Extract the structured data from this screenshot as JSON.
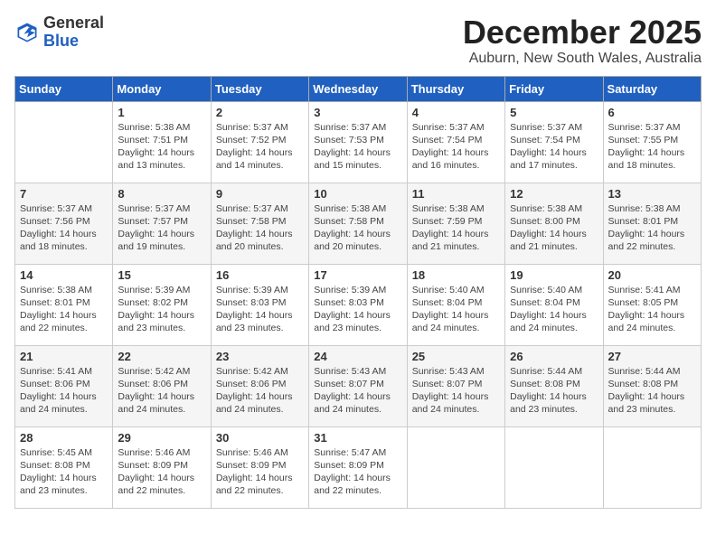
{
  "app": {
    "name_general": "General",
    "name_blue": "Blue"
  },
  "title": "December 2025",
  "location": "Auburn, New South Wales, Australia",
  "days_of_week": [
    "Sunday",
    "Monday",
    "Tuesday",
    "Wednesday",
    "Thursday",
    "Friday",
    "Saturday"
  ],
  "weeks": [
    [
      {
        "day": "",
        "info": ""
      },
      {
        "day": "1",
        "info": "Sunrise: 5:38 AM\nSunset: 7:51 PM\nDaylight: 14 hours\nand 13 minutes."
      },
      {
        "day": "2",
        "info": "Sunrise: 5:37 AM\nSunset: 7:52 PM\nDaylight: 14 hours\nand 14 minutes."
      },
      {
        "day": "3",
        "info": "Sunrise: 5:37 AM\nSunset: 7:53 PM\nDaylight: 14 hours\nand 15 minutes."
      },
      {
        "day": "4",
        "info": "Sunrise: 5:37 AM\nSunset: 7:54 PM\nDaylight: 14 hours\nand 16 minutes."
      },
      {
        "day": "5",
        "info": "Sunrise: 5:37 AM\nSunset: 7:54 PM\nDaylight: 14 hours\nand 17 minutes."
      },
      {
        "day": "6",
        "info": "Sunrise: 5:37 AM\nSunset: 7:55 PM\nDaylight: 14 hours\nand 18 minutes."
      }
    ],
    [
      {
        "day": "7",
        "info": "Sunrise: 5:37 AM\nSunset: 7:56 PM\nDaylight: 14 hours\nand 18 minutes."
      },
      {
        "day": "8",
        "info": "Sunrise: 5:37 AM\nSunset: 7:57 PM\nDaylight: 14 hours\nand 19 minutes."
      },
      {
        "day": "9",
        "info": "Sunrise: 5:37 AM\nSunset: 7:58 PM\nDaylight: 14 hours\nand 20 minutes."
      },
      {
        "day": "10",
        "info": "Sunrise: 5:38 AM\nSunset: 7:58 PM\nDaylight: 14 hours\nand 20 minutes."
      },
      {
        "day": "11",
        "info": "Sunrise: 5:38 AM\nSunset: 7:59 PM\nDaylight: 14 hours\nand 21 minutes."
      },
      {
        "day": "12",
        "info": "Sunrise: 5:38 AM\nSunset: 8:00 PM\nDaylight: 14 hours\nand 21 minutes."
      },
      {
        "day": "13",
        "info": "Sunrise: 5:38 AM\nSunset: 8:01 PM\nDaylight: 14 hours\nand 22 minutes."
      }
    ],
    [
      {
        "day": "14",
        "info": "Sunrise: 5:38 AM\nSunset: 8:01 PM\nDaylight: 14 hours\nand 22 minutes."
      },
      {
        "day": "15",
        "info": "Sunrise: 5:39 AM\nSunset: 8:02 PM\nDaylight: 14 hours\nand 23 minutes."
      },
      {
        "day": "16",
        "info": "Sunrise: 5:39 AM\nSunset: 8:03 PM\nDaylight: 14 hours\nand 23 minutes."
      },
      {
        "day": "17",
        "info": "Sunrise: 5:39 AM\nSunset: 8:03 PM\nDaylight: 14 hours\nand 23 minutes."
      },
      {
        "day": "18",
        "info": "Sunrise: 5:40 AM\nSunset: 8:04 PM\nDaylight: 14 hours\nand 24 minutes."
      },
      {
        "day": "19",
        "info": "Sunrise: 5:40 AM\nSunset: 8:04 PM\nDaylight: 14 hours\nand 24 minutes."
      },
      {
        "day": "20",
        "info": "Sunrise: 5:41 AM\nSunset: 8:05 PM\nDaylight: 14 hours\nand 24 minutes."
      }
    ],
    [
      {
        "day": "21",
        "info": "Sunrise: 5:41 AM\nSunset: 8:06 PM\nDaylight: 14 hours\nand 24 minutes."
      },
      {
        "day": "22",
        "info": "Sunrise: 5:42 AM\nSunset: 8:06 PM\nDaylight: 14 hours\nand 24 minutes."
      },
      {
        "day": "23",
        "info": "Sunrise: 5:42 AM\nSunset: 8:06 PM\nDaylight: 14 hours\nand 24 minutes."
      },
      {
        "day": "24",
        "info": "Sunrise: 5:43 AM\nSunset: 8:07 PM\nDaylight: 14 hours\nand 24 minutes."
      },
      {
        "day": "25",
        "info": "Sunrise: 5:43 AM\nSunset: 8:07 PM\nDaylight: 14 hours\nand 24 minutes."
      },
      {
        "day": "26",
        "info": "Sunrise: 5:44 AM\nSunset: 8:08 PM\nDaylight: 14 hours\nand 23 minutes."
      },
      {
        "day": "27",
        "info": "Sunrise: 5:44 AM\nSunset: 8:08 PM\nDaylight: 14 hours\nand 23 minutes."
      }
    ],
    [
      {
        "day": "28",
        "info": "Sunrise: 5:45 AM\nSunset: 8:08 PM\nDaylight: 14 hours\nand 23 minutes."
      },
      {
        "day": "29",
        "info": "Sunrise: 5:46 AM\nSunset: 8:09 PM\nDaylight: 14 hours\nand 22 minutes."
      },
      {
        "day": "30",
        "info": "Sunrise: 5:46 AM\nSunset: 8:09 PM\nDaylight: 14 hours\nand 22 minutes."
      },
      {
        "day": "31",
        "info": "Sunrise: 5:47 AM\nSunset: 8:09 PM\nDaylight: 14 hours\nand 22 minutes."
      },
      {
        "day": "",
        "info": ""
      },
      {
        "day": "",
        "info": ""
      },
      {
        "day": "",
        "info": ""
      }
    ]
  ]
}
